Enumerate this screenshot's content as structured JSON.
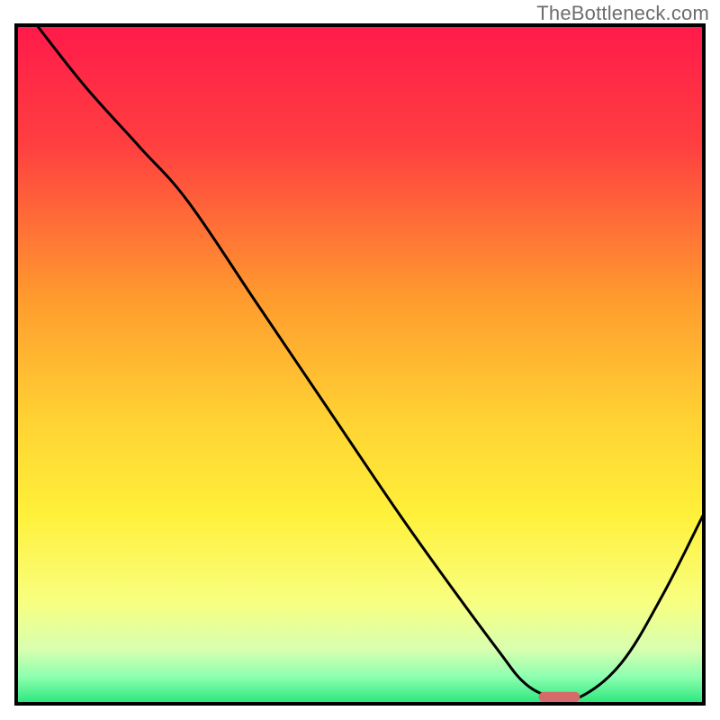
{
  "watermark": "TheBottleneck.com",
  "chart_data": {
    "type": "line",
    "title": "",
    "xlabel": "",
    "ylabel": "",
    "xlim": [
      0,
      100
    ],
    "ylim": [
      0,
      100
    ],
    "x": [
      3,
      10,
      18,
      25,
      35,
      45,
      55,
      62,
      70,
      74,
      78,
      82,
      88,
      94,
      100
    ],
    "values": [
      100,
      91,
      82,
      74,
      59,
      44,
      29,
      19,
      8,
      3,
      1,
      1,
      6,
      16,
      28
    ],
    "marker": {
      "x": 79,
      "y": 1,
      "width": 6,
      "height": 1.5,
      "color": "#d66a6a"
    },
    "gradient_stops": [
      {
        "offset": 0,
        "color": "#ff1a4a"
      },
      {
        "offset": 18,
        "color": "#ff4040"
      },
      {
        "offset": 40,
        "color": "#ff9a2e"
      },
      {
        "offset": 58,
        "color": "#ffd233"
      },
      {
        "offset": 72,
        "color": "#fff03a"
      },
      {
        "offset": 85,
        "color": "#f8ff80"
      },
      {
        "offset": 92,
        "color": "#d8ffb0"
      },
      {
        "offset": 96,
        "color": "#8dffb0"
      },
      {
        "offset": 100,
        "color": "#28e67a"
      }
    ],
    "frame_color": "#000000",
    "line_color": "#000000"
  }
}
